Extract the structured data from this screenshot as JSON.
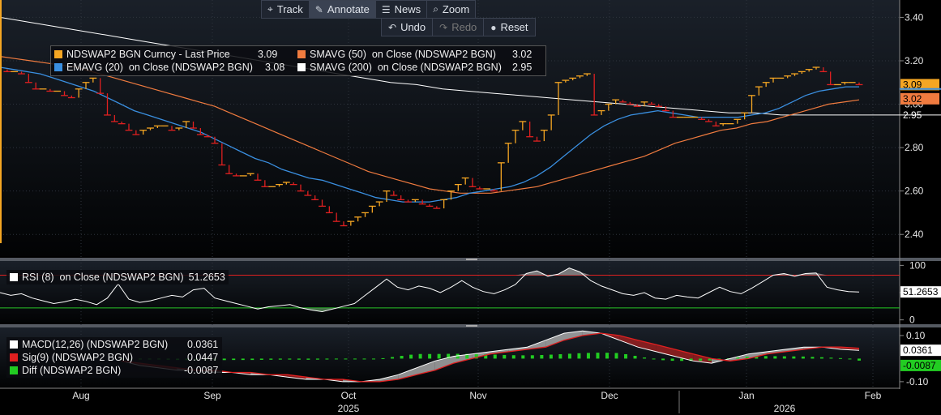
{
  "toolbar": {
    "items": [
      {
        "label": "Track",
        "icon": "crosshair-icon"
      },
      {
        "label": "Annotate",
        "icon": "pencil-icon"
      },
      {
        "label": "News",
        "icon": "news-icon"
      },
      {
        "label": "Zoom",
        "icon": "magnifier-icon"
      }
    ],
    "actions": [
      {
        "label": "Undo",
        "icon": "undo-icon"
      },
      {
        "label": "Redo",
        "icon": "redo-icon"
      },
      {
        "label": "Reset",
        "icon": "reset-icon"
      }
    ]
  },
  "legend_main": [
    {
      "label": "NDSWAP2 BGN Curncy - Last Price",
      "value": "3.09",
      "color": "#f5a623"
    },
    {
      "label": "EMAVG (20)  on Close (NDSWAP2 BGN)",
      "value": "3.08",
      "color": "#3a8fe0"
    },
    {
      "label": "SMAVG (50)  on Close (NDSWAP2 BGN)",
      "value": "3.02",
      "color": "#f07b3f"
    },
    {
      "label": "SMAVG (200)  on Close (NDSWAP2 BGN)",
      "value": "2.95",
      "color": "#ffffff"
    }
  ],
  "legend_rsi": [
    {
      "label": "RSI (8)  on Close (NDSWAP2 BGN)",
      "value": "51.2653",
      "color": "#ffffff"
    }
  ],
  "legend_macd": [
    {
      "label": "MACD(12,26) (NDSWAP2 BGN)",
      "value": "0.0361",
      "color": "#ffffff"
    },
    {
      "label": "Sig(9) (NDSWAP2 BGN)",
      "value": "0.0447",
      "color": "#e02020"
    },
    {
      "label": "Diff (NDSWAP2 BGN)",
      "value": "-0.0087",
      "color": "#22cc22"
    }
  ],
  "chart_data": [
    {
      "type": "line",
      "title": "",
      "x_labels": [
        "Aug",
        "Sep",
        "Oct",
        "Nov",
        "Dec",
        "Jan",
        "Feb"
      ],
      "year_labels": [
        "2025",
        "2026"
      ],
      "ylim": [
        2.3,
        3.48
      ],
      "y_ticks": [
        2.4,
        2.6,
        2.8,
        3.0,
        3.2,
        3.4
      ],
      "y_tick_labels": [
        "2.40",
        "2.60",
        "2.80",
        "3.00",
        "3.20",
        "3.40"
      ],
      "last_value_labels": [
        "3.09",
        "3.02",
        "2.95"
      ],
      "series": [
        {
          "name": "NDSWAP2 BGN Curncy - Last Price",
          "color": "#f5a623",
          "values": [
            3.16,
            3.15,
            3.15,
            3.14,
            3.1,
            3.07,
            3.07,
            3.06,
            3.06,
            3.04,
            3.03,
            3.07,
            3.1,
            3.12,
            3.05,
            2.95,
            2.92,
            2.91,
            2.88,
            2.86,
            2.88,
            2.89,
            2.9,
            2.9,
            2.88,
            2.89,
            2.92,
            2.89,
            2.86,
            2.85,
            2.82,
            2.72,
            2.68,
            2.67,
            2.67,
            2.68,
            2.65,
            2.62,
            2.62,
            2.63,
            2.64,
            2.63,
            2.6,
            2.58,
            2.56,
            2.53,
            2.5,
            2.46,
            2.44,
            2.46,
            2.48,
            2.5,
            2.53,
            2.55,
            2.6,
            2.58,
            2.56,
            2.55,
            2.56,
            2.54,
            2.53,
            2.52,
            2.56,
            2.6,
            2.63,
            2.66,
            2.62,
            2.61,
            2.61,
            2.6,
            2.73,
            2.82,
            2.88,
            2.92,
            2.85,
            2.83,
            2.88,
            2.95,
            3.1,
            3.11,
            3.12,
            3.13,
            3.14,
            2.95,
            2.97,
            3.0,
            3.02,
            3.01,
            3.0,
            2.99,
            3.01,
            3.0,
            2.99,
            2.97,
            2.94,
            2.94,
            2.94,
            2.94,
            2.93,
            2.92,
            2.9,
            2.91,
            2.91,
            2.93,
            2.96,
            3.04,
            3.08,
            3.1,
            3.12,
            3.12,
            3.13,
            3.14,
            3.15,
            3.16,
            3.17,
            3.15,
            3.09,
            3.09,
            3.1,
            3.1,
            3.09
          ]
        },
        {
          "name": "EMAVG (20)  on Close (NDSWAP2 BGN)",
          "color": "#3a8fe0",
          "values": [
            3.17,
            3.16,
            3.15,
            3.14,
            3.12,
            3.1,
            3.08,
            3.06,
            3.03,
            3.0,
            2.97,
            2.95,
            2.93,
            2.91,
            2.89,
            2.87,
            2.84,
            2.81,
            2.78,
            2.75,
            2.73,
            2.7,
            2.68,
            2.66,
            2.65,
            2.63,
            2.61,
            2.59,
            2.57,
            2.56,
            2.55,
            2.55,
            2.55,
            2.56,
            2.57,
            2.59,
            2.6,
            2.61,
            2.62,
            2.64,
            2.67,
            2.71,
            2.76,
            2.81,
            2.86,
            2.9,
            2.93,
            2.95,
            2.96,
            2.97,
            2.96,
            2.95,
            2.94,
            2.94,
            2.94,
            2.94,
            2.95,
            2.96,
            2.98,
            3.01,
            3.04,
            3.06,
            3.07,
            3.08,
            3.08
          ]
        },
        {
          "name": "SMAVG (50)  on Close (NDSWAP2 BGN)",
          "color": "#f07b3f",
          "values": [
            3.22,
            3.21,
            3.2,
            3.19,
            3.18,
            3.17,
            3.15,
            3.13,
            3.11,
            3.09,
            3.07,
            3.05,
            3.03,
            3.01,
            2.99,
            2.96,
            2.93,
            2.9,
            2.87,
            2.84,
            2.81,
            2.78,
            2.75,
            2.72,
            2.69,
            2.67,
            2.65,
            2.63,
            2.61,
            2.6,
            2.59,
            2.59,
            2.59,
            2.6,
            2.61,
            2.62,
            2.64,
            2.66,
            2.68,
            2.7,
            2.72,
            2.74,
            2.76,
            2.79,
            2.82,
            2.84,
            2.86,
            2.88,
            2.89,
            2.91,
            2.92,
            2.94,
            2.96,
            2.98,
            3.0,
            3.01,
            3.02
          ]
        },
        {
          "name": "SMAVG (200)  on Close (NDSWAP2 BGN)",
          "color": "#ffffff",
          "values": [
            3.4,
            3.38,
            3.36,
            3.34,
            3.32,
            3.3,
            3.28,
            3.26,
            3.24,
            3.22,
            3.2,
            3.18,
            3.16,
            3.14,
            3.12,
            3.1,
            3.09,
            3.07,
            3.06,
            3.05,
            3.04,
            3.03,
            3.02,
            3.01,
            3.0,
            2.99,
            2.98,
            2.97,
            2.96,
            2.96,
            2.95,
            2.95,
            2.95,
            2.95
          ]
        }
      ]
    },
    {
      "type": "line",
      "title": "",
      "ylim": [
        -5,
        108
      ],
      "y_ticks": [
        0,
        50,
        100
      ],
      "y_tick_labels": [
        "0",
        "50",
        "100"
      ],
      "reference_lines": [
        {
          "value": 82,
          "color": "#e02020"
        },
        {
          "value": 22,
          "color": "#22cc22"
        }
      ],
      "last_value_label": "51.2653",
      "series": [
        {
          "name": "RSI (8)  on Close (NDSWAP2 BGN)",
          "color": "#ffffff",
          "values": [
            50,
            45,
            48,
            40,
            35,
            30,
            33,
            38,
            34,
            28,
            40,
            66,
            38,
            32,
            35,
            40,
            45,
            42,
            55,
            58,
            40,
            35,
            30,
            25,
            20,
            24,
            26,
            28,
            22,
            18,
            15,
            20,
            25,
            30,
            45,
            60,
            75,
            60,
            55,
            62,
            58,
            50,
            60,
            72,
            60,
            52,
            48,
            55,
            65,
            85,
            90,
            80,
            84,
            95,
            88,
            72,
            62,
            55,
            48,
            45,
            50,
            40,
            38,
            45,
            42,
            40,
            50,
            60,
            52,
            48,
            58,
            70,
            82,
            85,
            80,
            85,
            86,
            60,
            55,
            52,
            51
          ]
        }
      ]
    },
    {
      "type": "area",
      "title": "",
      "ylim": [
        -0.125,
        0.135
      ],
      "y_ticks": [
        0.1,
        -0.1
      ],
      "y_tick_labels": [
        "0.10",
        "-0.10"
      ],
      "last_value_labels": [
        "0.0361",
        "-0.0087"
      ],
      "series": [
        {
          "name": "MACD(12,26) (NDSWAP2 BGN)",
          "color": "#ffffff",
          "values": [
            -0.01,
            -0.03,
            -0.04,
            -0.05,
            -0.05,
            -0.06,
            -0.06,
            -0.07,
            -0.07,
            -0.08,
            -0.09,
            -0.09,
            -0.1,
            -0.1,
            -0.09,
            -0.07,
            -0.04,
            -0.01,
            0.01,
            0.02,
            0.03,
            0.04,
            0.05,
            0.08,
            0.11,
            0.12,
            0.11,
            0.08,
            0.05,
            0.03,
            0.01,
            -0.01,
            -0.02,
            0.0,
            0.02,
            0.03,
            0.04,
            0.05,
            0.05,
            0.04,
            0.036
          ]
        },
        {
          "name": "Sig(9) (NDSWAP2 BGN)",
          "color": "#e02020",
          "values": [
            -0.01,
            -0.02,
            -0.03,
            -0.04,
            -0.05,
            -0.05,
            -0.06,
            -0.06,
            -0.07,
            -0.07,
            -0.08,
            -0.09,
            -0.09,
            -0.1,
            -0.1,
            -0.09,
            -0.07,
            -0.05,
            -0.02,
            0.0,
            0.02,
            0.03,
            0.04,
            0.05,
            0.08,
            0.1,
            0.11,
            0.1,
            0.08,
            0.06,
            0.04,
            0.02,
            0.0,
            -0.01,
            0.0,
            0.02,
            0.03,
            0.04,
            0.05,
            0.05,
            0.0447
          ]
        },
        {
          "name": "Diff (NDSWAP2 BGN)",
          "color": "#22cc22",
          "values": [
            0.0,
            0.0,
            -0.003,
            -0.006,
            -0.007,
            -0.007,
            -0.006,
            -0.006,
            -0.005,
            -0.004,
            -0.005,
            -0.004,
            -0.003,
            -0.002,
            0.0,
            0.01,
            0.02,
            0.02,
            0.021,
            0.02,
            0.018,
            0.015,
            0.014,
            0.016,
            0.02,
            0.024,
            0.026,
            0.024,
            0.01,
            -0.005,
            -0.01,
            -0.01,
            -0.008,
            0.002,
            0.009,
            0.011,
            0.01,
            0.009,
            0.006,
            0.002,
            -0.0087
          ]
        }
      ]
    }
  ]
}
